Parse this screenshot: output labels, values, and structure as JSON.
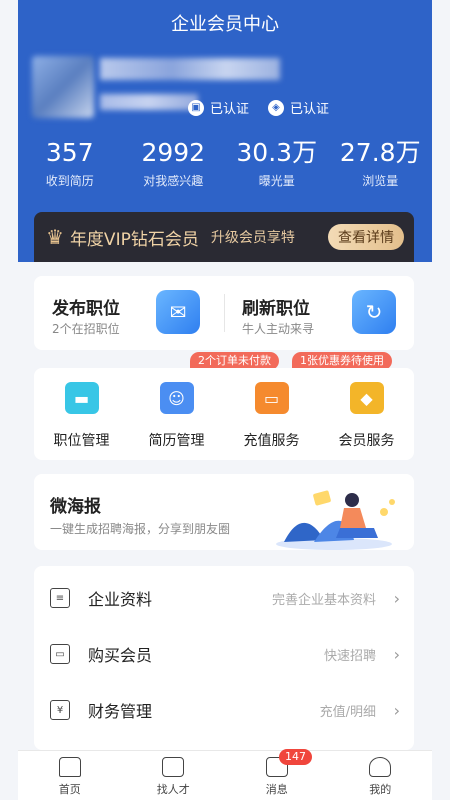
{
  "header": {
    "title": "企业会员中心",
    "cert_1": "已认证",
    "cert_2": "已认证"
  },
  "stats": [
    {
      "num": "357",
      "label": "收到简历"
    },
    {
      "num": "2992",
      "label": "对我感兴趣"
    },
    {
      "num": "30.3万",
      "label": "曝光量"
    },
    {
      "num": "27.8万",
      "label": "浏览量"
    }
  ],
  "vip": {
    "title": "年度VIP钻石会员",
    "subtitle": "升级会员享特",
    "button": "查看详情"
  },
  "jobs": {
    "post_title": "发布职位",
    "post_sub": "2个在招职位",
    "refresh_title": "刷新职位",
    "refresh_sub": "牛人主动来寻"
  },
  "tags": {
    "orders": "2个订单未付款",
    "coupons": "1张优惠券待使用"
  },
  "services": [
    {
      "label": "职位管理",
      "color": "#38c6e6"
    },
    {
      "label": "简历管理",
      "color": "#4b8ef2"
    },
    {
      "label": "充值服务",
      "color": "#f58a2e"
    },
    {
      "label": "会员服务",
      "color": "#f3b529"
    }
  ],
  "poster": {
    "title": "微海报",
    "subtitle": "一键生成招聘海报，分享到朋友圈"
  },
  "menu": [
    {
      "label": "企业资料",
      "hint": "完善企业基本资料",
      "icon": "document-icon"
    },
    {
      "label": "购买会员",
      "hint": "快速招聘",
      "icon": "wallet-icon"
    },
    {
      "label": "财务管理",
      "hint": "充值/明细",
      "icon": "yuan-icon"
    }
  ],
  "tabbar": [
    {
      "label": "首页",
      "icon": "home-icon"
    },
    {
      "label": "找人才",
      "icon": "talent-icon"
    },
    {
      "label": "消息",
      "icon": "message-icon",
      "badge": "147"
    },
    {
      "label": "我的",
      "icon": "user-icon"
    }
  ],
  "colors": {
    "header_bg": "#2e63c8",
    "vip_bg": "#2a2a33",
    "badge_red": "#f0463c"
  }
}
